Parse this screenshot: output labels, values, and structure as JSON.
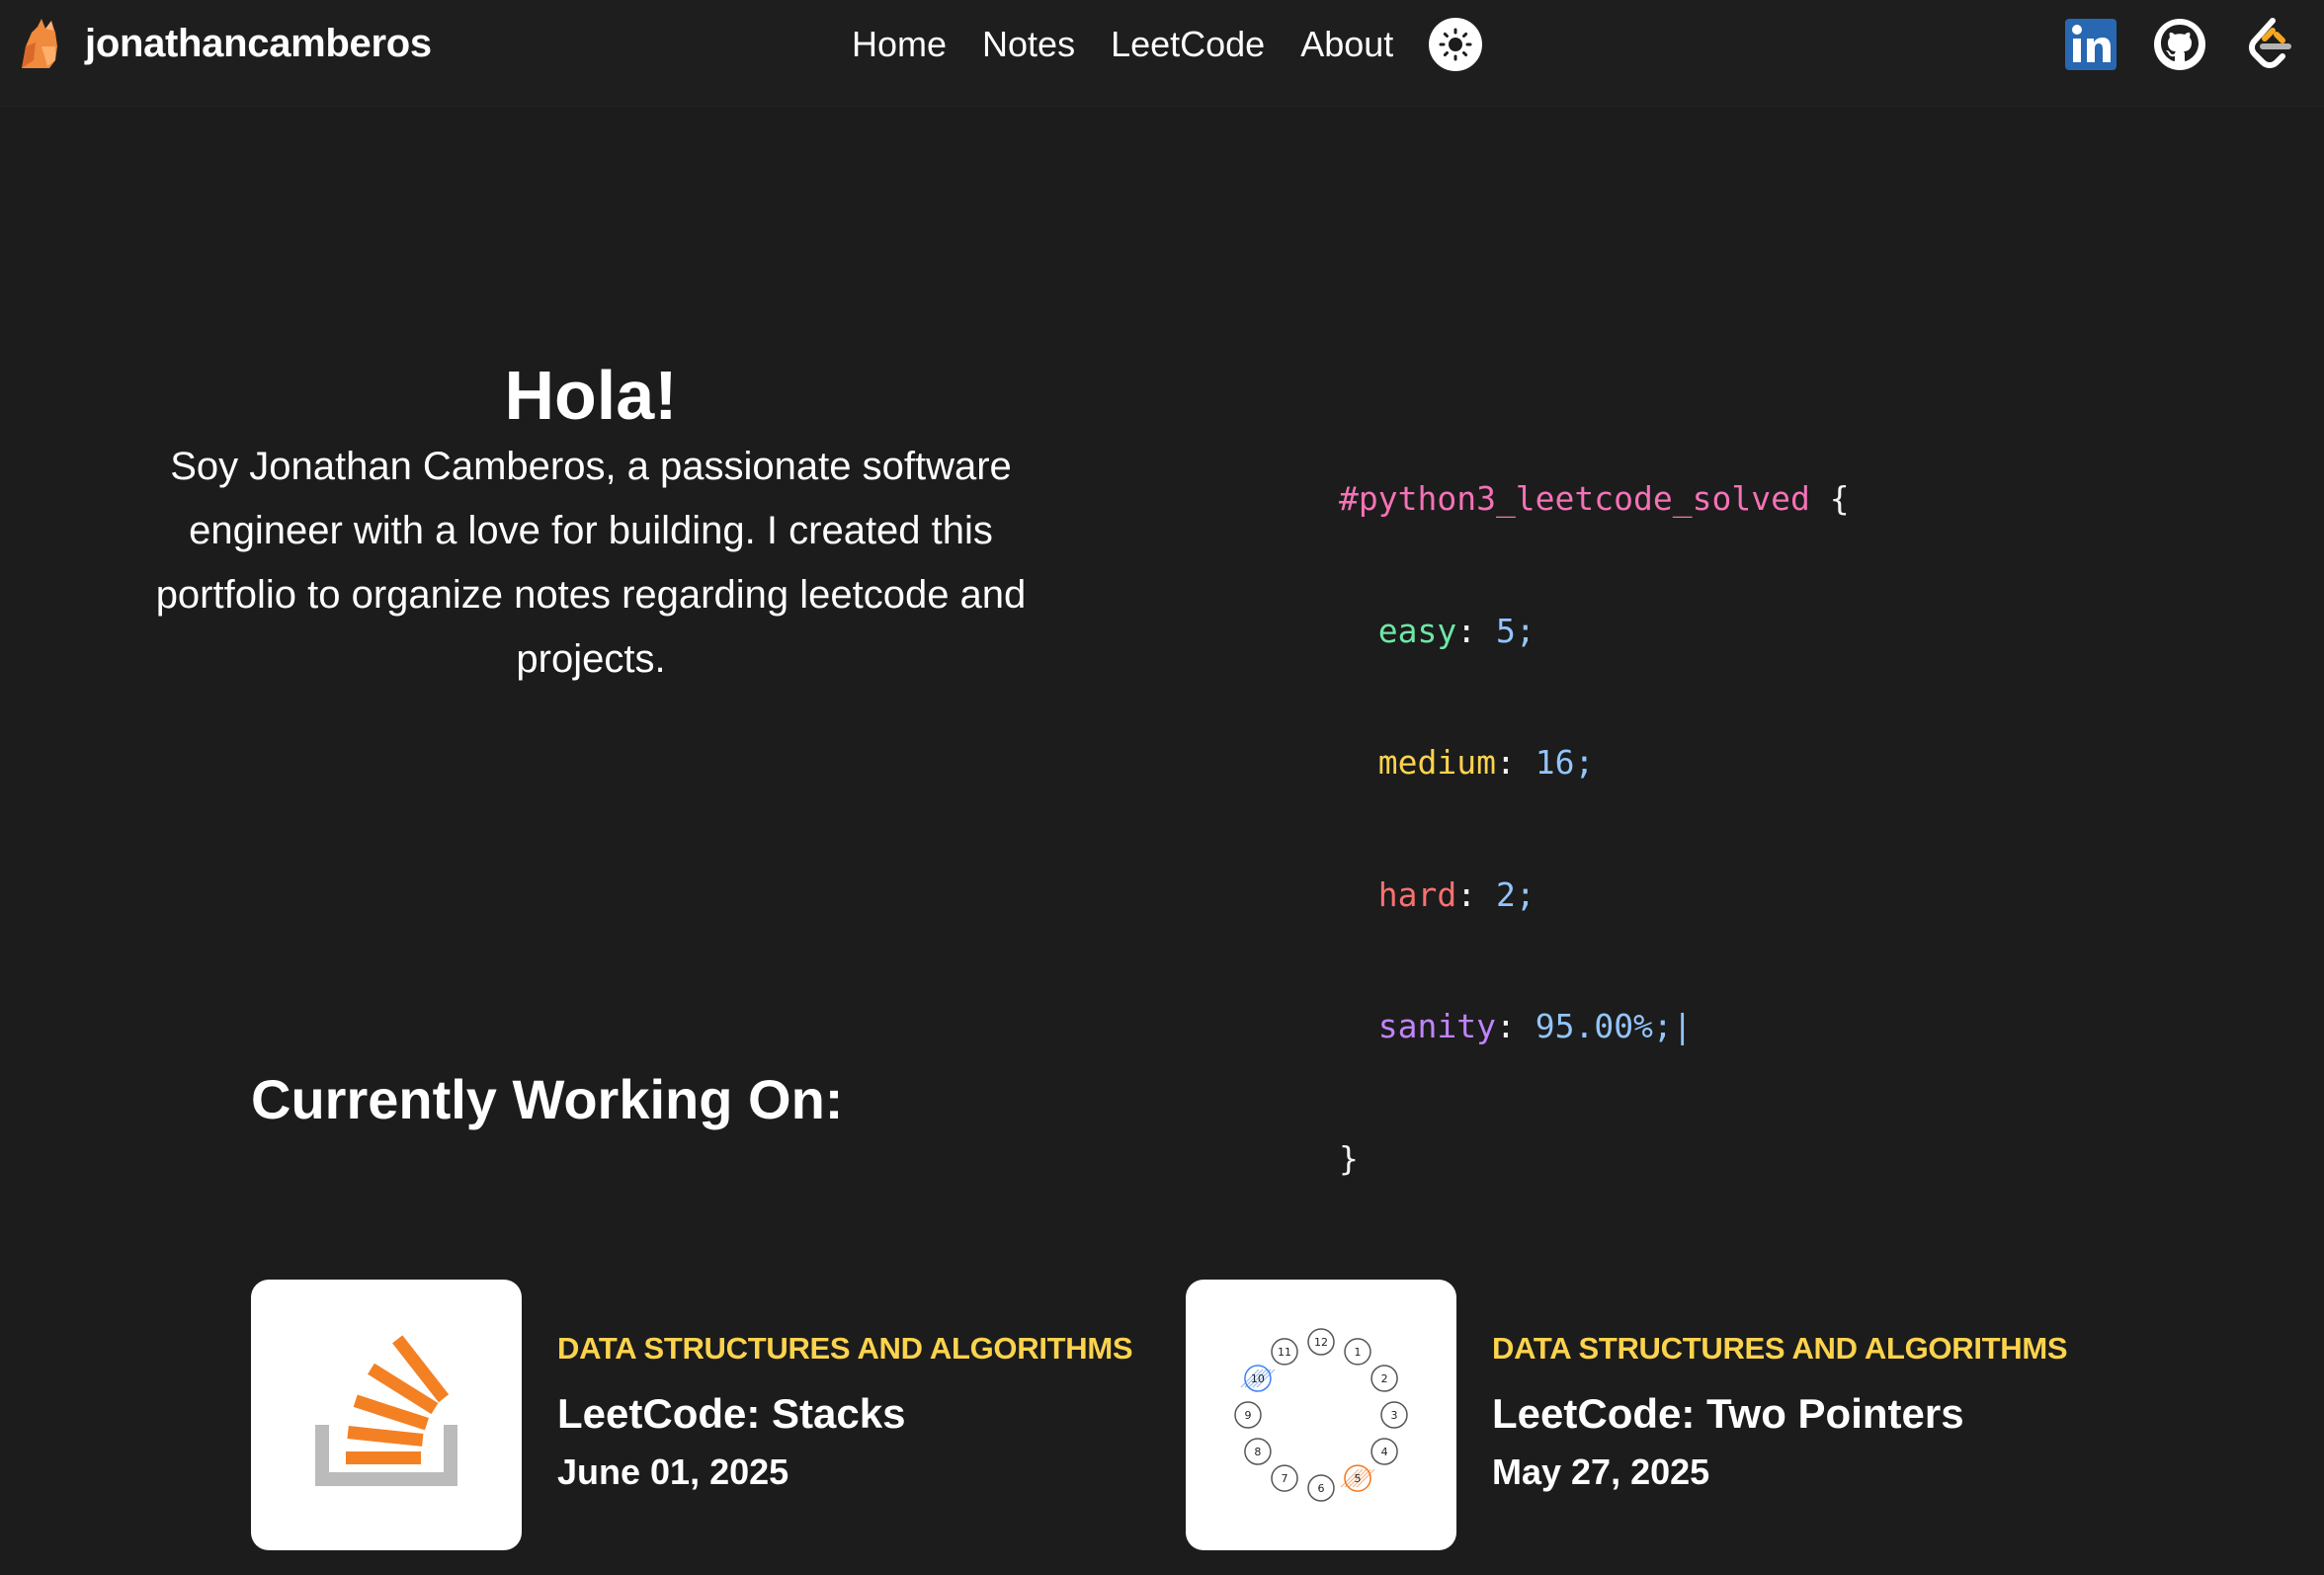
{
  "header": {
    "brand_name": "jonathancamberos",
    "nav": [
      {
        "label": "Home"
      },
      {
        "label": "Notes"
      },
      {
        "label": "LeetCode"
      },
      {
        "label": "About"
      }
    ],
    "social": [
      {
        "icon": "linkedin-icon"
      },
      {
        "icon": "github-icon"
      },
      {
        "icon": "leetcode-icon"
      }
    ]
  },
  "hero": {
    "title": "Hola!",
    "text": "Soy Jonathan Camberos, a passionate software engineer with a love for building. I created this portfolio to organize notes regarding leetcode and projects."
  },
  "code": {
    "selector": "#python3_leetcode_solved",
    "open_brace": "{",
    "close_brace": "}",
    "easy_key": "easy",
    "easy_value": "5;",
    "medium_key": "medium",
    "medium_value": "16;",
    "hard_key": "hard",
    "hard_value": "2;",
    "sanity_key": "sanity",
    "sanity_value": "95.00%;",
    "cursor": "|"
  },
  "working_on": {
    "title": "Currently Working On:",
    "cards": [
      {
        "category": "DATA STRUCTURES AND ALGORITHMS",
        "title": "LeetCode: Stacks",
        "date": "June 01, 2025",
        "thumb_icon": "stack-overflow-icon"
      },
      {
        "category": "DATA STRUCTURES AND ALGORITHMS",
        "title": "LeetCode: Two Pointers",
        "date": "May 27, 2025",
        "thumb_icon": "circular-nodes-diagram",
        "diagram_nodes": [
          "12",
          "1",
          "2",
          "3",
          "4",
          "5",
          "6",
          "7",
          "8",
          "9",
          "10",
          "11"
        ]
      }
    ]
  },
  "colors": {
    "background": "#1c1c1c",
    "category_accent": "#fcd34d",
    "code_selector": "#f472b6",
    "code_easy": "#6ee7a7",
    "code_medium": "#fcd34d",
    "code_hard": "#f87171",
    "code_sanity": "#c084fc",
    "code_number": "#93c5fd",
    "linkedin_blue": "#2867b2",
    "stackoverflow_orange": "#f48024"
  }
}
